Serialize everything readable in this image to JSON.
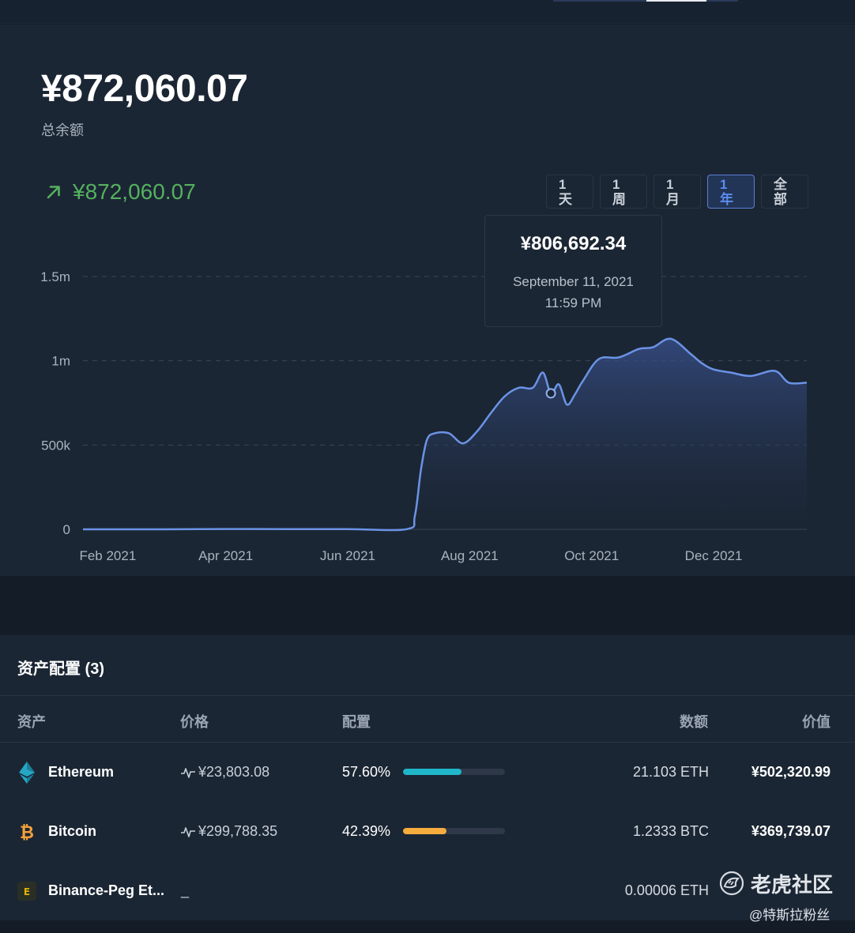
{
  "balance": {
    "amount": "¥872,060.07",
    "label": "总余额"
  },
  "change": {
    "amount": "¥872,060.07",
    "direction": "up",
    "color": "#55b15f"
  },
  "range_buttons": [
    {
      "line1": "1",
      "line2": "天",
      "active": false
    },
    {
      "line1": "1",
      "line2": "周",
      "active": false
    },
    {
      "line1": "1",
      "line2": "月",
      "active": false
    },
    {
      "line1": "1",
      "line2": "年",
      "active": true
    },
    {
      "line1": "全",
      "line2": "部",
      "active": false
    }
  ],
  "tooltip": {
    "value": "¥806,692.34",
    "date": "September 11, 2021",
    "time": "11:59 PM"
  },
  "chart_data": {
    "type": "area",
    "y_ticks": [
      "0",
      "500k",
      "1m",
      "1.5m"
    ],
    "ylim": [
      0,
      1500000
    ],
    "x_ticks": [
      "Feb 2021",
      "Apr 2021",
      "Jun 2021",
      "Aug 2021",
      "Oct 2021",
      "Dec 2021"
    ],
    "grid": true,
    "line_color": "#6b93e6",
    "hover_point": {
      "x": "2021-09-11",
      "y": 806692.34
    },
    "x": [
      "2021-01-20",
      "2021-02-01",
      "2021-03-01",
      "2021-04-01",
      "2021-05-01",
      "2021-06-01",
      "2021-07-01",
      "2021-07-05",
      "2021-07-08",
      "2021-07-11",
      "2021-07-15",
      "2021-07-22",
      "2021-07-29",
      "2021-08-05",
      "2021-08-12",
      "2021-08-19",
      "2021-08-26",
      "2021-09-02",
      "2021-09-07",
      "2021-09-11",
      "2021-09-15",
      "2021-09-19",
      "2021-09-23",
      "2021-09-27",
      "2021-10-05",
      "2021-10-15",
      "2021-10-25",
      "2021-11-01",
      "2021-11-10",
      "2021-11-20",
      "2021-11-25",
      "2021-12-01",
      "2021-12-10",
      "2021-12-20",
      "2022-01-01",
      "2022-01-08",
      "2022-01-17"
    ],
    "values": [
      0,
      0,
      0,
      2000,
      1000,
      1000,
      1000,
      80000,
      350000,
      530000,
      570000,
      570000,
      510000,
      580000,
      690000,
      790000,
      840000,
      840000,
      930000,
      806692,
      860000,
      740000,
      800000,
      880000,
      1010000,
      1020000,
      1070000,
      1080000,
      1130000,
      1040000,
      990000,
      950000,
      930000,
      910000,
      940000,
      870000,
      870000
    ]
  },
  "assets": {
    "title": "资产配置 (3)",
    "headers": {
      "asset": "资产",
      "price": "价格",
      "allocation": "配置",
      "amount": "数额",
      "value": "价值"
    },
    "rows": [
      {
        "icon": "ethereum-icon",
        "name": "Ethereum",
        "price": "¥23,803.08",
        "pct": "57.60%",
        "fraction": 0.576,
        "bar_color": "#1fb6c9",
        "amount": "21.103 ETH",
        "value": "¥502,320.99"
      },
      {
        "icon": "bitcoin-icon",
        "name": "Bitcoin",
        "price": "¥299,788.35",
        "pct": "42.39%",
        "fraction": 0.4239,
        "bar_color": "#f4ad3d",
        "amount": "1.2333 BTC",
        "value": "¥369,739.07"
      },
      {
        "icon": "binance-peg-icon",
        "name": "Binance-Peg Et...",
        "price": "_",
        "pct": "",
        "fraction": 0,
        "bar_color": "#2e3848",
        "amount": "0.00006 ETH",
        "value": ""
      }
    ]
  },
  "watermark": {
    "title": "老虎社区",
    "subtitle": "@特斯拉粉丝"
  }
}
